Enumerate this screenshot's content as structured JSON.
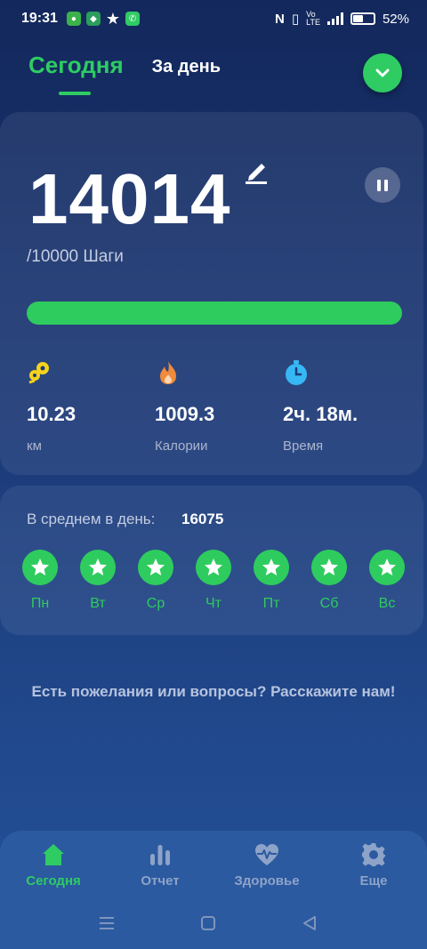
{
  "status_bar": {
    "time": "19:31",
    "battery_percent": "52%",
    "battery_level": 0.52
  },
  "tabs": {
    "today": "Сегодня",
    "per_day": "За день"
  },
  "steps": {
    "value": "14014",
    "goal_text": "/10000 Шаги",
    "progress_percent": 100
  },
  "stats": [
    {
      "value": "10.23",
      "label": "км",
      "icon": "distance-icon",
      "color": "#f5d31d"
    },
    {
      "value": "1009.3",
      "label": "Калории",
      "icon": "flame-icon",
      "color": "#f08a3c"
    },
    {
      "value": "2ч. 18м.",
      "label": "Время",
      "icon": "timer-icon",
      "color": "#36b8f4"
    }
  ],
  "weekly": {
    "avg_label": "В среднем в день:",
    "avg_value": "16075",
    "days": [
      "Пн",
      "Вт",
      "Ср",
      "Чт",
      "Пт",
      "Сб",
      "Вс"
    ]
  },
  "feedback_text": "Есть пожелания или вопросы? Расскажите нам!",
  "bottom_nav": [
    {
      "label": "Сегодня",
      "icon": "home-icon",
      "active": true
    },
    {
      "label": "Отчет",
      "icon": "bar-chart-icon",
      "active": false
    },
    {
      "label": "Здоровье",
      "icon": "heart-pulse-icon",
      "active": false
    },
    {
      "label": "Еще",
      "icon": "gear-icon",
      "active": false
    }
  ],
  "colors": {
    "accent": "#2ecc63",
    "background": "#1c3a78",
    "nav": "#2b5aa0"
  }
}
